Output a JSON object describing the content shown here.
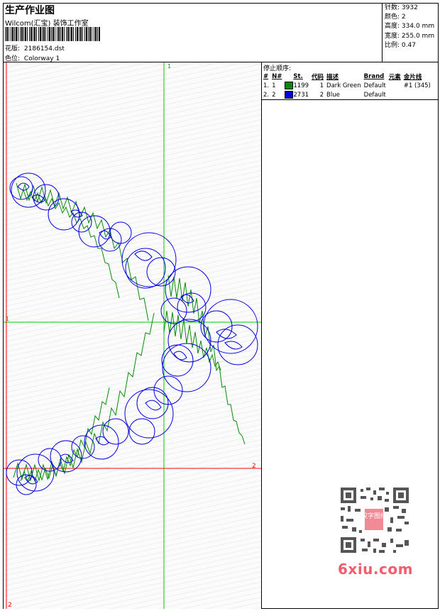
{
  "header": {
    "title": "生产作业图",
    "company": "Wilcom(汇宝) 装饰工作室",
    "design_label": "花版:",
    "design_value": "2186154.dst",
    "colorway_label": "色位:",
    "colorway_value": "Colorway 1"
  },
  "stats": [
    {
      "label": "针数:",
      "value": "3932"
    },
    {
      "label": "颜色:",
      "value": "2"
    },
    {
      "label": "高度:",
      "value": "334.0 mm"
    },
    {
      "label": "宽度:",
      "value": "255.0 mm"
    },
    {
      "label": "比例:",
      "value": "0.47"
    }
  ],
  "stop_sequence": {
    "label": "停止顺序:",
    "columns": [
      "#",
      "N#",
      "St.",
      "代码",
      "描述",
      "Brand",
      "元素",
      "金片线"
    ],
    "rows": [
      {
        "num": "1.",
        "n": "1",
        "color": "#0a8a0a",
        "st": "1199",
        "code": "1",
        "desc": "Dark Green",
        "brand": "Default",
        "element": "",
        "sequin": "#1 (345)"
      },
      {
        "num": "2.",
        "n": "2",
        "color": "#0000e6",
        "st": "2731",
        "code": "2",
        "desc": "Blue",
        "brand": "Default",
        "element": "",
        "sequin": ""
      }
    ]
  },
  "guides": {
    "top_mark": "1",
    "left_mark": "1",
    "right_mark": "2",
    "bottom_mark": "2"
  },
  "watermark": {
    "text": "6xiu.com",
    "stamp": "汉字图纸"
  },
  "colors": {
    "green_guide": "#00cc00",
    "red_guide": "#ff0000",
    "blue_stitch": "#0000e6",
    "green_stitch": "#0a8a0a"
  }
}
